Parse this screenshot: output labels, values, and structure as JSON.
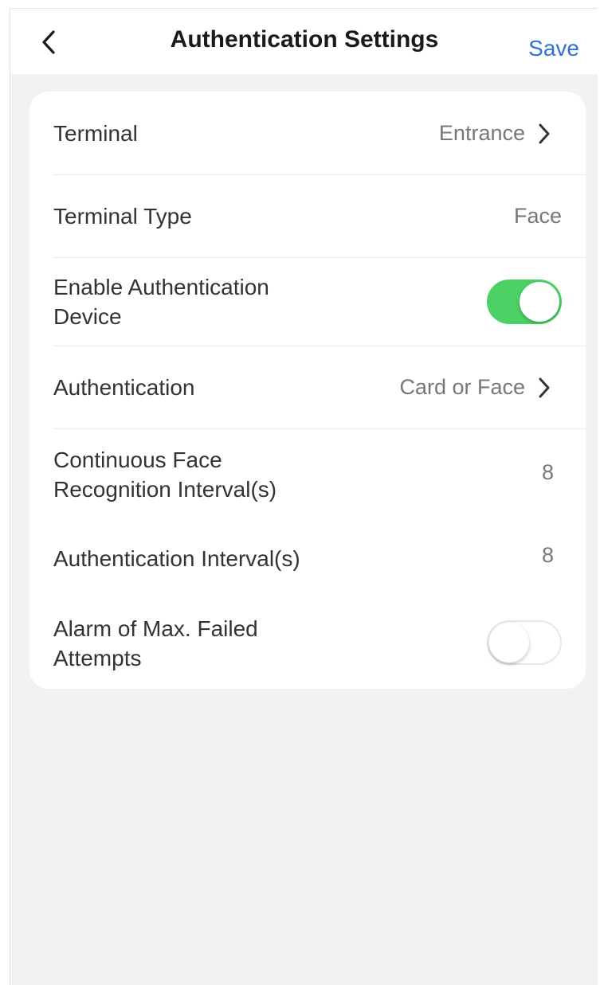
{
  "header": {
    "title": "Authentication Settings",
    "save_label": "Save",
    "back_icon": "chevron-left-icon"
  },
  "colors": {
    "accent": "#2f6fde",
    "toggle_on": "#4cd165",
    "background": "#f2f2f2"
  },
  "settings": {
    "terminal": {
      "label": "Terminal",
      "value": "Entrance"
    },
    "terminal_type": {
      "label": "Terminal Type",
      "value": "Face"
    },
    "enable_auth_device": {
      "label_line1": "Enable Authentication",
      "label_line2": "Device",
      "enabled": true
    },
    "authentication": {
      "label": "Authentication",
      "value": "Card or Face"
    },
    "face_interval": {
      "label_line1": "Continuous Face",
      "label_line2": "Recognition Interval(s)",
      "value": "8"
    },
    "auth_interval": {
      "label": "Authentication Interval(s)",
      "value": "8"
    },
    "max_failed_alarm": {
      "label_line1": "Alarm of Max. Failed",
      "label_line2": "Attempts",
      "enabled": false
    }
  }
}
